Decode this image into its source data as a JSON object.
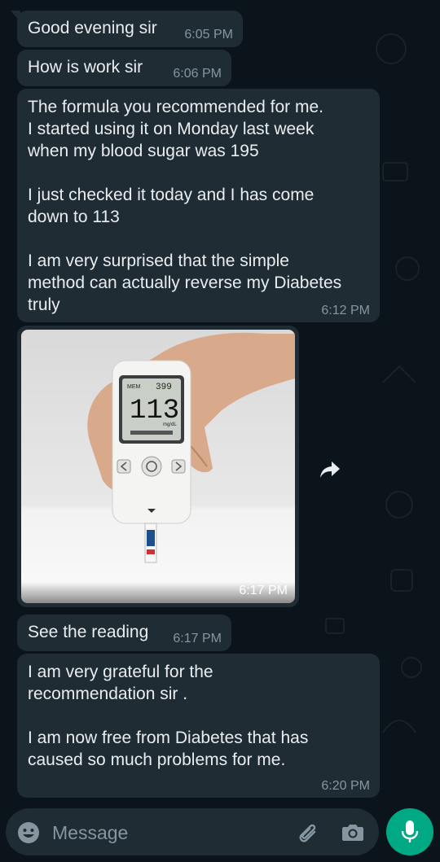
{
  "messages": [
    {
      "text": "Good evening sir",
      "time": "6:05 PM"
    },
    {
      "text": "How is work sir",
      "time": "6:06 PM"
    },
    {
      "text": "The formula you recommended for me.\nI started using it on Monday last week\nwhen my blood sugar was 195\n\nI just checked it today and I has come\ndown to 113\n\nI am very surprised that the simple\nmethod can actually reverse my Diabetes\ntruly",
      "time": "6:12 PM"
    },
    {
      "image": {
        "meter_top_value": "399",
        "meter_reading": "113",
        "meter_unit": "mg/dL",
        "meter_label": "MEM"
      },
      "time": "6:17 PM"
    },
    {
      "text": "See the reading",
      "time": "6:17 PM"
    },
    {
      "text": "I am very grateful for the\nrecommendation sir .\n\nI am now free from Diabetes that has\ncaused so much problems for me.",
      "time": "6:20 PM"
    }
  ],
  "composer": {
    "placeholder": "Message",
    "icons": [
      "emoji-icon",
      "attach-icon",
      "camera-icon",
      "mic-icon"
    ]
  },
  "colors": {
    "background": "#0b141a",
    "bubble": "#202c33",
    "accent": "#00a884",
    "timestamp": "#8696a0"
  }
}
